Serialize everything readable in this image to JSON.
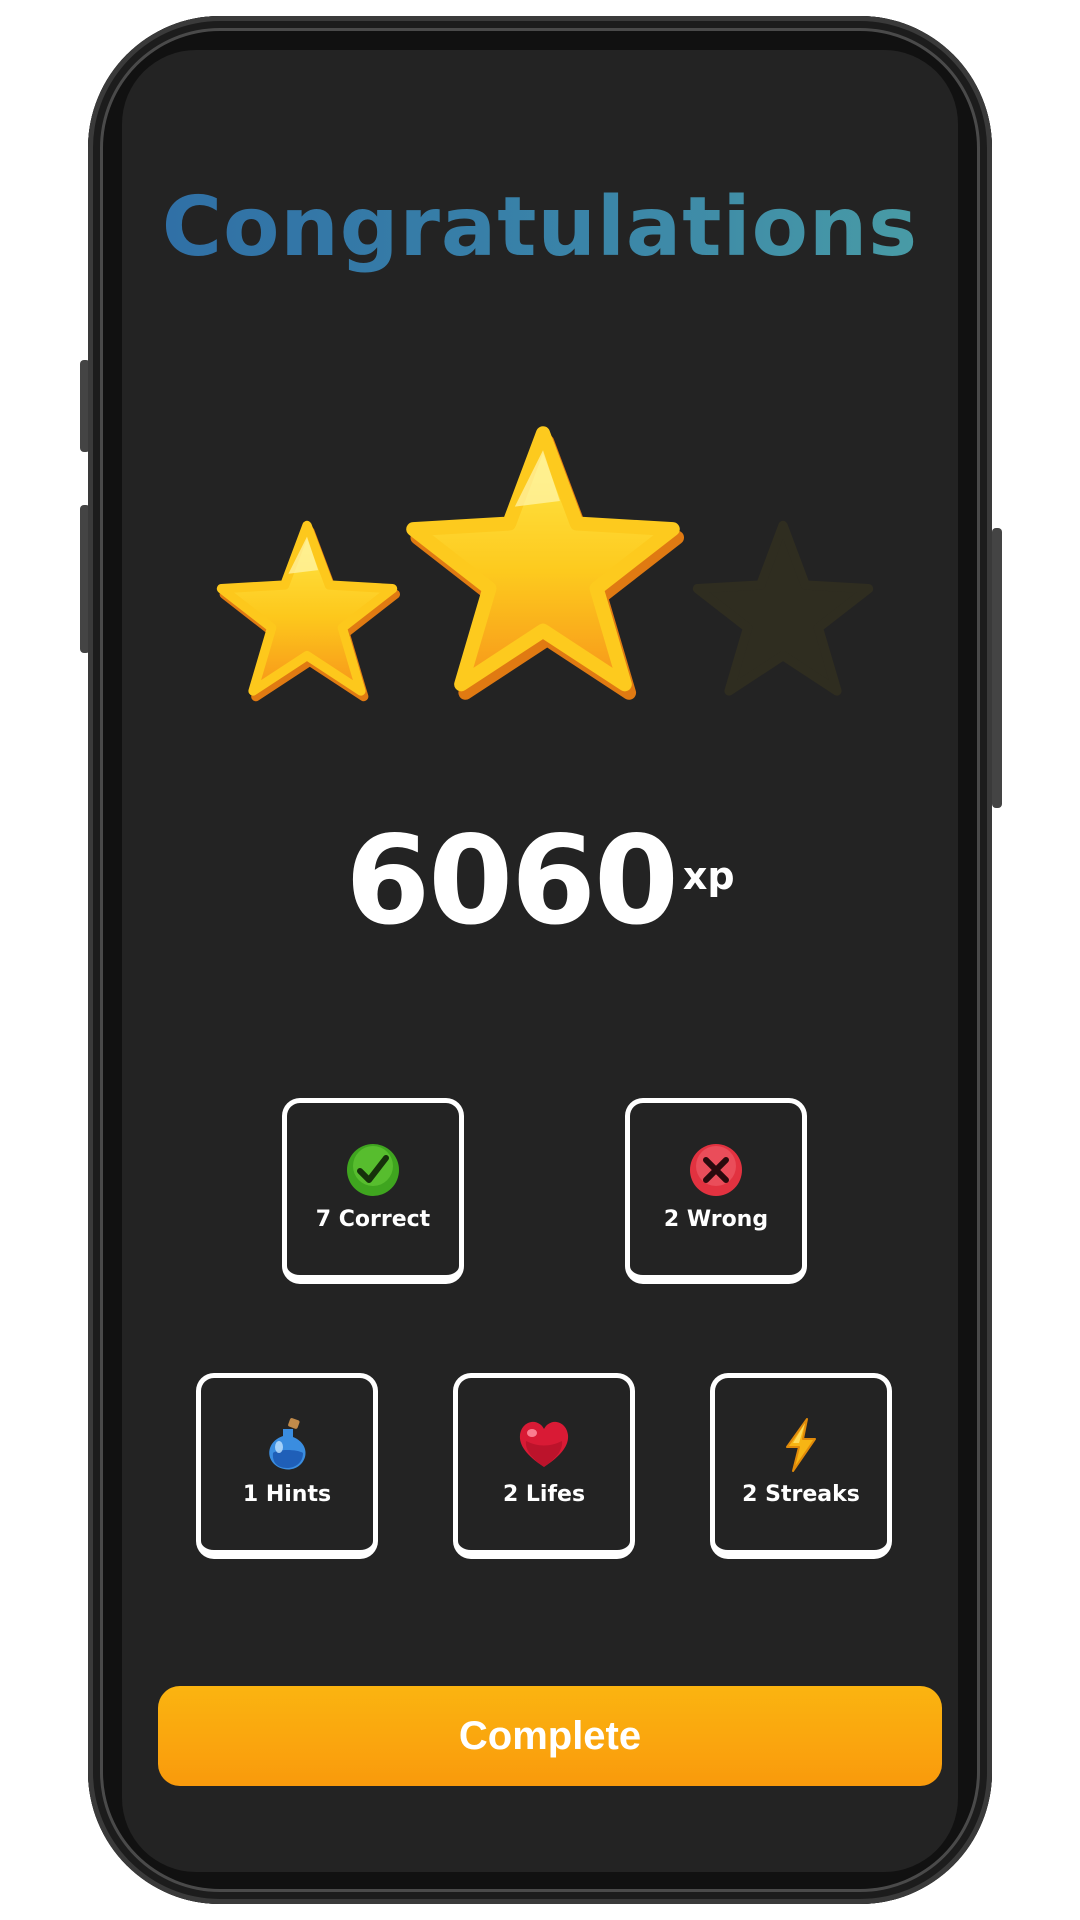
{
  "header": {
    "title": "Congratulations"
  },
  "rating": {
    "stars_earned": 2,
    "stars_total": 3
  },
  "score": {
    "value": "6060",
    "unit": "xp"
  },
  "stats": {
    "correct": {
      "label": "7 Correct",
      "icon": "check-circle-icon"
    },
    "wrong": {
      "label": "2 Wrong",
      "icon": "cross-circle-icon"
    },
    "hints": {
      "label": "1 Hints",
      "icon": "potion-icon"
    },
    "lifes": {
      "label": "2 Lifes",
      "icon": "heart-icon"
    },
    "streaks": {
      "label": "2 Streaks",
      "icon": "lightning-icon"
    }
  },
  "actions": {
    "complete_label": "Complete"
  },
  "colors": {
    "screen_background": "#232323",
    "title_gradient_start": "#2f6ea6",
    "title_gradient_end": "#4a9ea6",
    "star_gold": "#fbc21a",
    "button_orange": "#f9a00c",
    "correct_green": "#3fa51f",
    "wrong_red": "#e23240"
  }
}
